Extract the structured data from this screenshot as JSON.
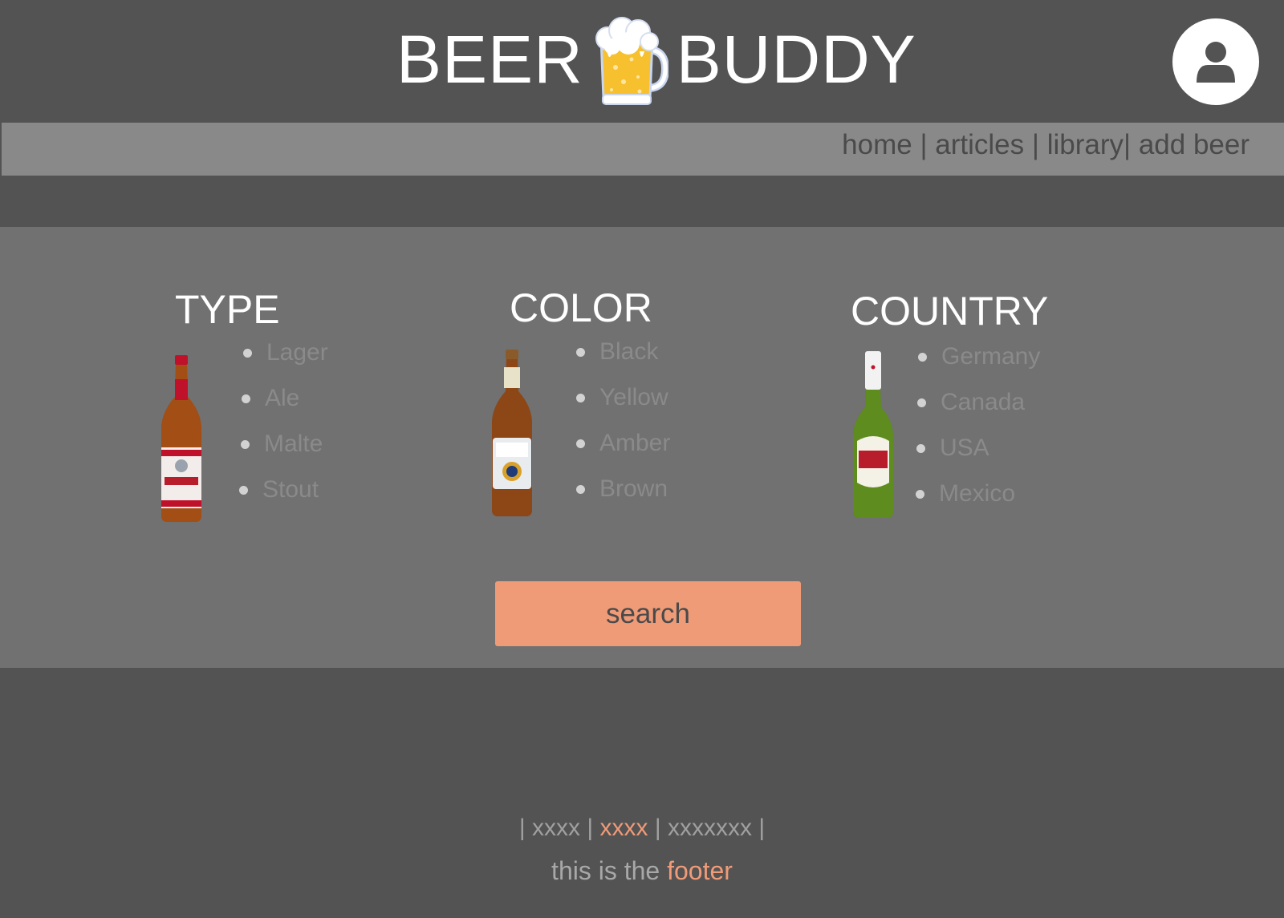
{
  "header": {
    "logo_left": "BEER",
    "logo_right": "BUDDY"
  },
  "nav": {
    "home": "home",
    "articles": "articles",
    "library": "library",
    "add_beer": "add beer",
    "separator": " | "
  },
  "filters": {
    "type": {
      "title": "TYPE",
      "options": [
        "Lager",
        "Ale",
        "Malte",
        "Stout"
      ]
    },
    "color": {
      "title": "COLOR",
      "options": [
        "Black",
        "Yellow",
        "Amber",
        "Brown"
      ]
    },
    "country": {
      "title": "COUNTRY",
      "options": [
        "Germany",
        "Canada",
        "USA",
        "Mexico"
      ]
    }
  },
  "search": {
    "label": "search"
  },
  "footer": {
    "link1": "xxxx",
    "link2": "xxxx",
    "link3": "xxxxxxx",
    "pipe": "|",
    "text_prefix": "this is the",
    "text_accent": "footer"
  },
  "colors": {
    "background": "#535353",
    "nav_bar": "#898989",
    "panel": "#717171",
    "accent": "#f09b78"
  }
}
